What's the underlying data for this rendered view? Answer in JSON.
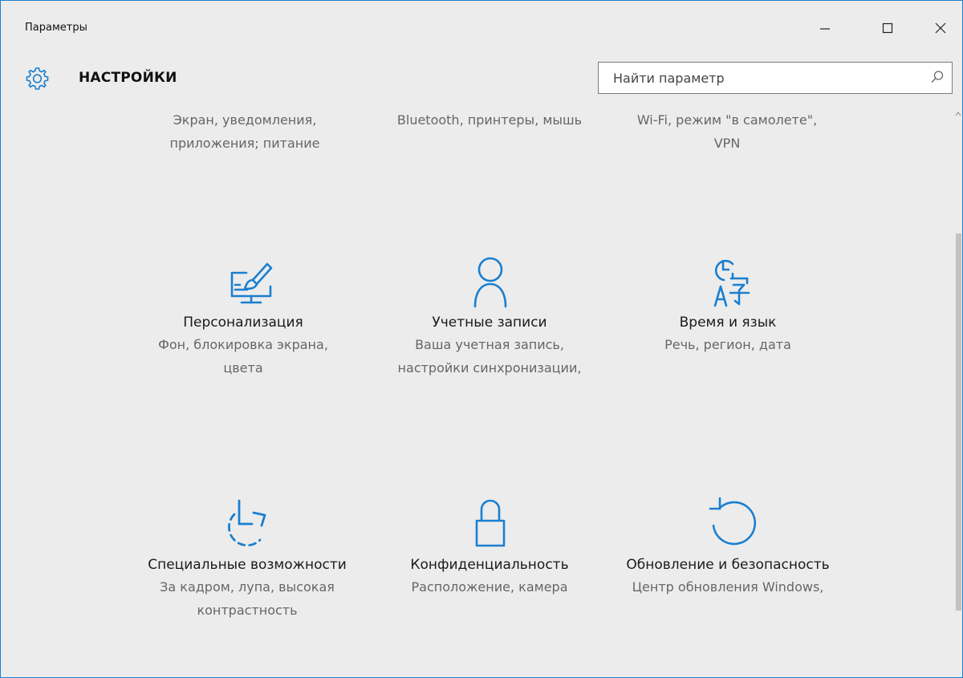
{
  "window": {
    "title": "Параметры"
  },
  "header": {
    "app_title": "НАСТРОЙКИ",
    "search_placeholder": "Найти параметр"
  },
  "tiles_row1": [
    {
      "title": "",
      "desc": "Экран, уведомления, приложения; питание"
    },
    {
      "title": "",
      "desc": "Bluetooth, принтеры, мышь"
    },
    {
      "title": "",
      "desc": "Wi-Fi, режим \"в самолете\", VPN"
    }
  ],
  "tiles_row2": [
    {
      "icon": "personalization-icon",
      "title": "Персонализация",
      "desc": "Фон, блокировка экрана, цвета"
    },
    {
      "icon": "accounts-icon",
      "title": "Учетные записи",
      "desc": "Ваша учетная запись, настройки синхронизации,"
    },
    {
      "icon": "time-language-icon",
      "title": "Время и язык",
      "desc": "Речь, регион, дата"
    }
  ],
  "tiles_row3": [
    {
      "icon": "accessibility-icon",
      "title": "Специальные возможности",
      "desc": "За кадром, лупа, высокая контрастность"
    },
    {
      "icon": "privacy-lock-icon",
      "title": "Конфиденциальность",
      "desc": "Расположение, камера"
    },
    {
      "icon": "update-security-icon",
      "title": "Обновление и безопасность",
      "desc": "Центр обновления Windows,"
    }
  ],
  "colors": {
    "accent": "#1a7fd0",
    "background": "#ececec",
    "desc_text": "#666666"
  }
}
